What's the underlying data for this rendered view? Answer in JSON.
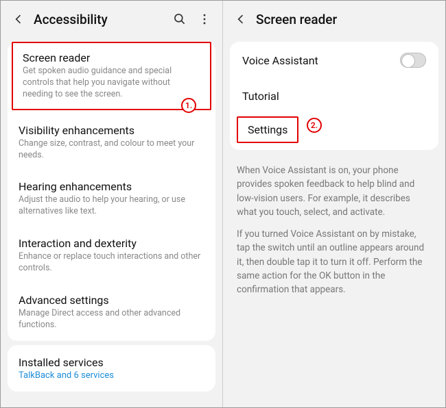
{
  "left": {
    "title": "Accessibility",
    "items": [
      {
        "title": "Screen reader",
        "desc": "Get spoken audio guidance and special controls that help you navigate without needing to see the screen."
      },
      {
        "title": "Visibility enhancements",
        "desc": "Change size, contrast, and colour to meet your needs."
      },
      {
        "title": "Hearing enhancements",
        "desc": "Adjust the audio to help your hearing, or use alternatives like text."
      },
      {
        "title": "Interaction and dexterity",
        "desc": "Enhance or replace touch interactions and other controls."
      },
      {
        "title": "Advanced settings",
        "desc": "Manage Direct access and other advanced functions."
      }
    ],
    "installed": {
      "title": "Installed services",
      "link": "TalkBack and 6 services"
    },
    "badge1": "1."
  },
  "right": {
    "title": "Screen reader",
    "voice_assistant": "Voice Assistant",
    "tutorial": "Tutorial",
    "settings": "Settings",
    "badge2": "2.",
    "info1": "When Voice Assistant is on, your phone provides spoken feedback to help blind and low-vision users. For example, it describes what you touch, select, and activate.",
    "info2": "If you turned Voice Assistant on by mistake, tap the switch until an outline appears around it, then double tap it to turn it off. Perform the same action for the OK button in the confirmation that appears."
  }
}
